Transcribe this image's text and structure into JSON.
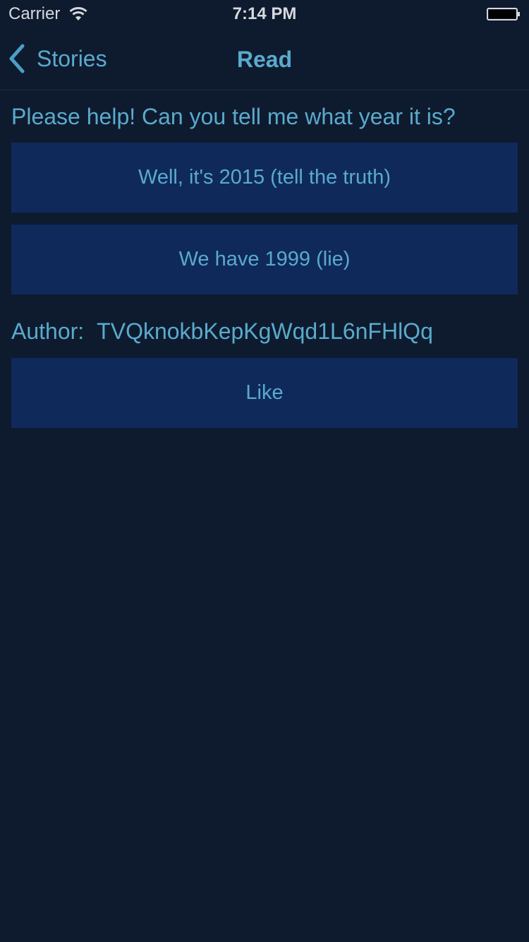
{
  "status_bar": {
    "carrier": "Carrier",
    "time": "7:14 PM"
  },
  "nav": {
    "back_label": "Stories",
    "title": "Read"
  },
  "story": {
    "question": "Please help! Can you tell me what year it is?",
    "choices": [
      "Well, it's 2015 (tell the truth)",
      "We have 1999 (lie)"
    ],
    "author_label": "Author:",
    "author_id": "TVQknokbKepKgWqd1L6nFHlQq",
    "like_label": "Like"
  },
  "colors": {
    "background": "#0e1b2e",
    "accent": "#5aaacd",
    "button": "#0f295b"
  }
}
